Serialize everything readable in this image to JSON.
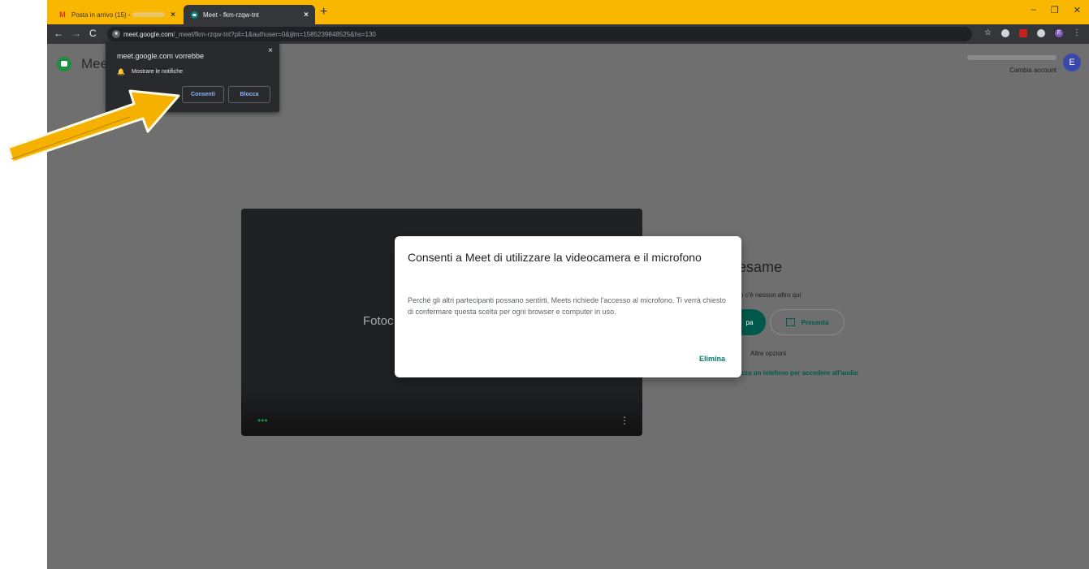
{
  "browser": {
    "tabs": [
      {
        "label": "Posta in arrivo (15) -",
        "close": "×"
      },
      {
        "label": "Meet - fkm-rzqw-tnt",
        "close": "×"
      }
    ],
    "new_tab": "+",
    "window_controls": {
      "minimize": "–",
      "restore": "❐",
      "close": "✕"
    },
    "address": {
      "domain": "meet.google.com",
      "path": "/_meet/fkm-rzqw-tnt?pli=1&authuser=0&ijlm=1585239848525&hs=130"
    },
    "extension_letter": "E"
  },
  "page": {
    "app_name": "Meet",
    "account": {
      "switch": "Cambia account",
      "avatar_letter": "E"
    },
    "preview_text": "Fotoc",
    "meeting_title": "esame",
    "no_one_here": "n c'è nessun altro qui",
    "join_label": "pa",
    "present_label": "Presenta",
    "more_options": "Altre opzioni",
    "phone_link": "zza un telefono per accedere all'audio"
  },
  "permission_popup": {
    "title": "meet.google.com vorrebbe",
    "item": "Mostrare le notifiche",
    "allow": "Consenti",
    "block": "Blocca",
    "close": "×"
  },
  "dialog": {
    "title": "Consenti a Meet di utilizzare la videocamera e il microfono",
    "body": "Perché gli altri partecipanti possano sentirti, Meets richiede l'accesso al microfono. Ti verrà chiesto di confermare questa scelta per ogni browser e computer in uso.",
    "dismiss": "Elimina"
  },
  "colors": {
    "tab_bar": "#f9b701",
    "arrow": "#f5b000",
    "accent": "#00796b"
  }
}
